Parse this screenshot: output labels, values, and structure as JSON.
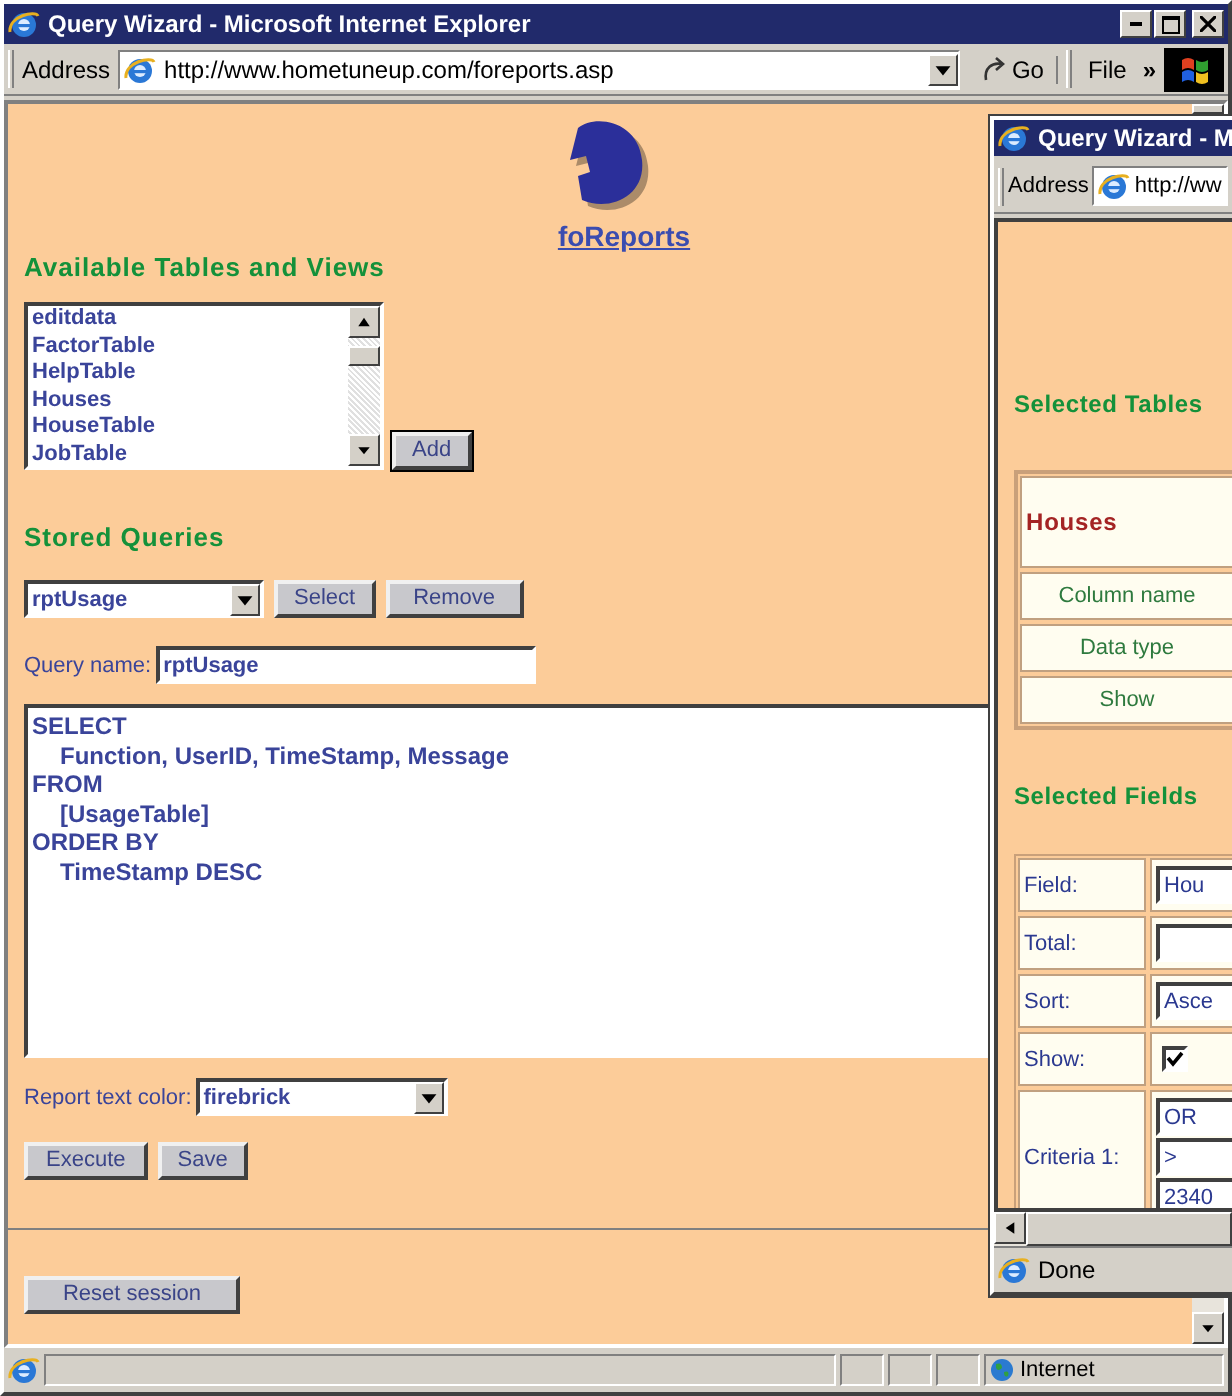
{
  "main_window": {
    "title": "Query Wizard - Microsoft Internet Explorer",
    "toolbar": {
      "address_label": "Address",
      "url": "http://www.hometuneup.com/foreports.asp",
      "go": "Go",
      "menu": "File",
      "chevron": "»"
    },
    "page": {
      "brand": "foReports",
      "tables_heading": "Available Tables and Views",
      "tables": [
        "editdata",
        "FactorTable",
        "HelpTable",
        "Houses",
        "HouseTable",
        "JobTable"
      ],
      "add": "Add",
      "stored_heading": "Stored Queries",
      "stored_query": "rptUsage",
      "select": "Select",
      "remove": "Remove",
      "query_name_label": "Query name:",
      "query_name": "rptUsage",
      "sql": [
        {
          "text": "SELECT",
          "children": [
            {
              "text": "Function, UserID, TimeStamp, Message"
            }
          ]
        },
        {
          "text": "FROM",
          "children": [
            {
              "text": "[UsageTable]"
            }
          ]
        },
        {
          "text": "ORDER BY",
          "children": [
            {
              "text": "TimeStamp DESC"
            }
          ]
        }
      ],
      "color_label": "Report text color:",
      "color_value": "firebrick",
      "execute": "Execute",
      "save": "Save",
      "reset": "Reset session"
    },
    "status_bar": {
      "zone": "Internet"
    }
  },
  "popup_window": {
    "title": "Query Wizard - M",
    "address_label": "Address",
    "url": "http://ww",
    "tables_heading": "Selected Tables",
    "table_name": "Houses",
    "table_rows": [
      "Column name",
      "Data type",
      "Show"
    ],
    "fields_heading": "Selected Fields",
    "fields": [
      {
        "label": "Field:",
        "kind": "text",
        "value": "Hou"
      },
      {
        "label": "Total:",
        "kind": "text"
      },
      {
        "label": "Sort:",
        "kind": "text",
        "value": "Asce"
      },
      {
        "label": "Show:",
        "kind": "checkbox",
        "checked": true
      },
      {
        "label": "Criteria 1:",
        "kind": "stack",
        "values": [
          "OR",
          ">",
          "2340"
        ]
      }
    ],
    "status": "Done"
  }
}
